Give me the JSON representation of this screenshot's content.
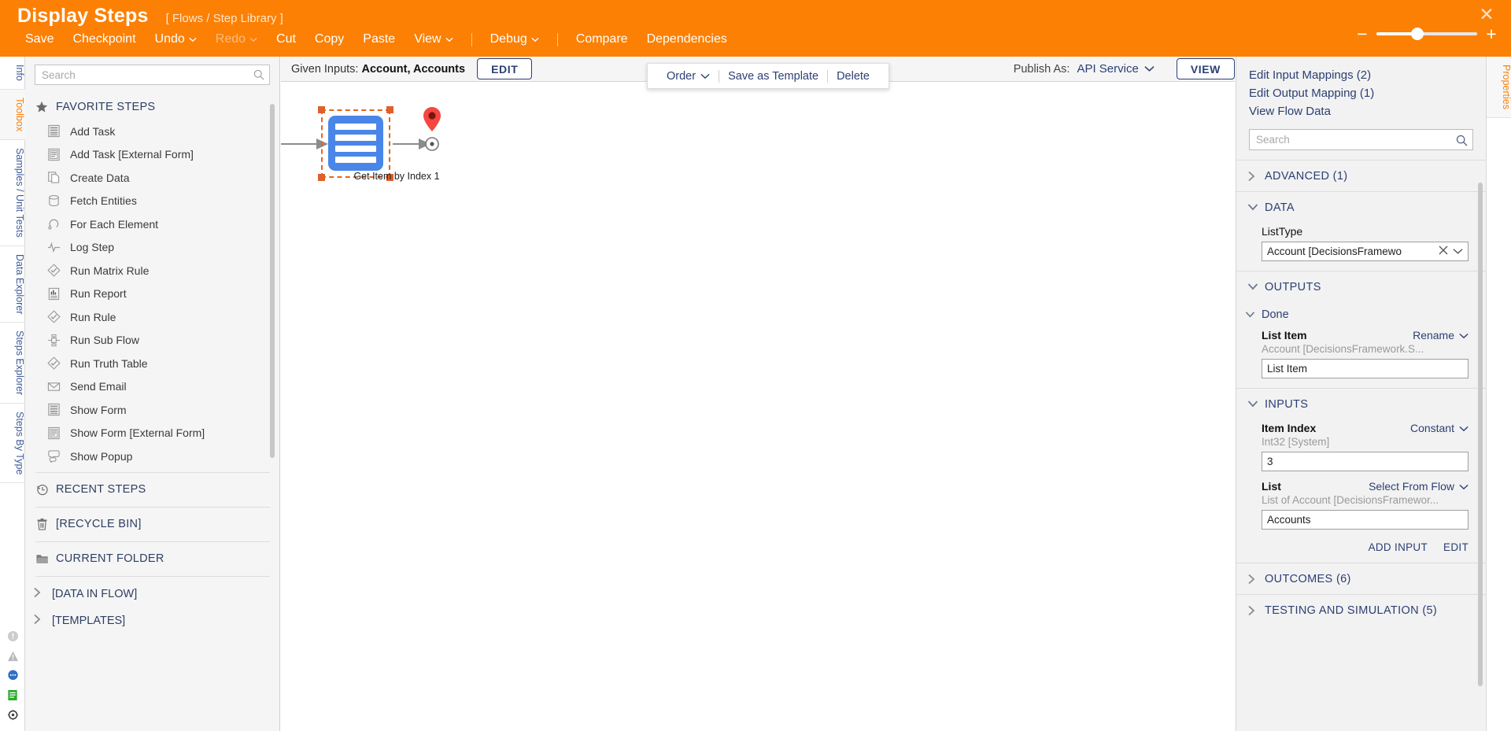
{
  "header": {
    "title": "Display Steps",
    "breadcrumb": "[ Flows / Step Library ]",
    "close_icon": "close-icon",
    "menu": [
      {
        "label": "Save",
        "caret": false,
        "disabled": false
      },
      {
        "label": "Checkpoint",
        "caret": false,
        "disabled": false
      },
      {
        "label": "Undo",
        "caret": true,
        "disabled": false
      },
      {
        "label": "Redo",
        "caret": true,
        "disabled": true
      },
      {
        "label": "Cut",
        "caret": false,
        "disabled": false
      },
      {
        "label": "Copy",
        "caret": false,
        "disabled": false
      },
      {
        "label": "Paste",
        "caret": false,
        "disabled": false
      },
      {
        "label": "View",
        "caret": true,
        "disabled": false
      },
      {
        "label": "Debug",
        "caret": true,
        "disabled": false
      },
      {
        "label": "Compare",
        "caret": false,
        "disabled": false
      },
      {
        "label": "Dependencies",
        "caret": false,
        "disabled": false
      }
    ],
    "zoom": {
      "minus": "−",
      "plus": "+",
      "value": 38
    }
  },
  "left_rail": {
    "tabs": [
      {
        "label": "Info",
        "active": false
      },
      {
        "label": "Toolbox",
        "active": true
      },
      {
        "label": "Samples / Unit Tests",
        "active": false
      },
      {
        "label": "Data Explorer",
        "active": false
      },
      {
        "label": "Steps Explorer",
        "active": false
      },
      {
        "label": "Steps By Type",
        "active": false
      }
    ],
    "status_icons": [
      "info-circle-icon",
      "warning-triangle-icon",
      "chat-bubble-icon",
      "document-icon",
      "settings-gear-icon"
    ]
  },
  "toolbox": {
    "search": {
      "value": "",
      "placeholder": "Search",
      "icon": "search-icon"
    },
    "groups": [
      {
        "label": "FAVORITE STEPS",
        "icon": "star-icon",
        "items": [
          {
            "label": "Add Task",
            "icon": "form-rows-icon"
          },
          {
            "label": "Add Task [External Form]",
            "icon": "external-form-icon"
          },
          {
            "label": "Create Data",
            "icon": "copy-pages-icon"
          },
          {
            "label": "Fetch Entities",
            "icon": "database-cylinder-icon"
          },
          {
            "label": "For Each Element",
            "icon": "loop-arrow-icon"
          },
          {
            "label": "Log Step",
            "icon": "waveform-icon"
          },
          {
            "label": "Run Matrix Rule",
            "icon": "diamond-check-icon"
          },
          {
            "label": "Run Report",
            "icon": "report-chart-icon"
          },
          {
            "label": "Run Rule",
            "icon": "diamond-check-icon"
          },
          {
            "label": "Run Sub Flow",
            "icon": "subflow-icon"
          },
          {
            "label": "Run Truth Table",
            "icon": "diamond-check-icon"
          },
          {
            "label": "Send Email",
            "icon": "envelope-icon"
          },
          {
            "label": "Show Form",
            "icon": "form-rows-icon"
          },
          {
            "label": "Show Form [External Form]",
            "icon": "external-form-icon"
          },
          {
            "label": "Show Popup",
            "icon": "popup-bubbles-icon"
          }
        ]
      }
    ],
    "sections": [
      {
        "label": "RECENT STEPS",
        "icon": "history-clock-icon"
      },
      {
        "label": "[RECYCLE BIN]",
        "icon": "trash-icon"
      },
      {
        "label": "CURRENT FOLDER",
        "icon": "folder-icon"
      }
    ],
    "tree": [
      {
        "label": "[DATA IN FLOW]",
        "icon": "chevron-right-icon"
      },
      {
        "label": "[TEMPLATES]",
        "icon": "chevron-right-icon"
      }
    ]
  },
  "canvas_toolbar": {
    "given_inputs_label": "Given Inputs:",
    "given_inputs_value": "Account, Accounts",
    "edit_label": "EDIT",
    "publish_label": "Publish As:",
    "publish_value": "API Service",
    "view_label": "VIEW"
  },
  "context_menu": {
    "items": [
      {
        "label": "Order",
        "caret": true
      },
      {
        "label": "Save as Template",
        "caret": false
      },
      {
        "label": "Delete",
        "caret": false
      }
    ]
  },
  "flow": {
    "start_marker": "start-pin-icon",
    "end_marker": "end-pin-icon",
    "node_label": "Get Item by Index 1",
    "node_icon": "form-rows-icon",
    "node_color": "#4a86e8",
    "selection_color": "#E8631A"
  },
  "properties": {
    "links": [
      "Edit Input Mappings (2)",
      "Edit Output Mapping (1)",
      "View Flow Data"
    ],
    "search": {
      "value": "",
      "placeholder": "Search",
      "icon": "search-icon"
    },
    "advanced": {
      "label": "ADVANCED (1)",
      "expanded": false
    },
    "data": {
      "label": "DATA",
      "expanded": true,
      "list_type_label": "ListType",
      "list_type_value": "Account   [DecisionsFramewo",
      "clear_icon": "close-icon",
      "dropdown_icon": "chevron-down-icon"
    },
    "outputs": {
      "label": "OUTPUTS",
      "expanded": true,
      "done": {
        "label": "Done",
        "expanded": true,
        "field_label": "List Item",
        "action": "Rename",
        "type_hint": "Account [DecisionsFramework.S...",
        "value": "List Item"
      }
    },
    "inputs": {
      "label": "INPUTS",
      "expanded": true,
      "fields": [
        {
          "label": "Item Index",
          "action": "Constant",
          "type_hint": "Int32 [System]",
          "value": "3"
        },
        {
          "label": "List",
          "action": "Select From Flow",
          "type_hint": "List of Account [DecisionsFramewor...",
          "value": "Accounts"
        }
      ],
      "add_input_label": "ADD INPUT",
      "edit_label": "EDIT"
    },
    "outcomes": {
      "label": "OUTCOMES (6)",
      "expanded": false
    },
    "testing": {
      "label": "TESTING AND SIMULATION (5)",
      "expanded": false
    }
  },
  "right_rail": {
    "tabs": [
      {
        "label": "Properties",
        "active": true
      }
    ]
  },
  "colors": {
    "accent_orange": "#FC8004",
    "link_navy": "#2b3f73",
    "panel_bg": "#f2f2f2",
    "node_blue": "#4a86e8",
    "start_green": "#12C412",
    "end_red": "#F4473F"
  }
}
